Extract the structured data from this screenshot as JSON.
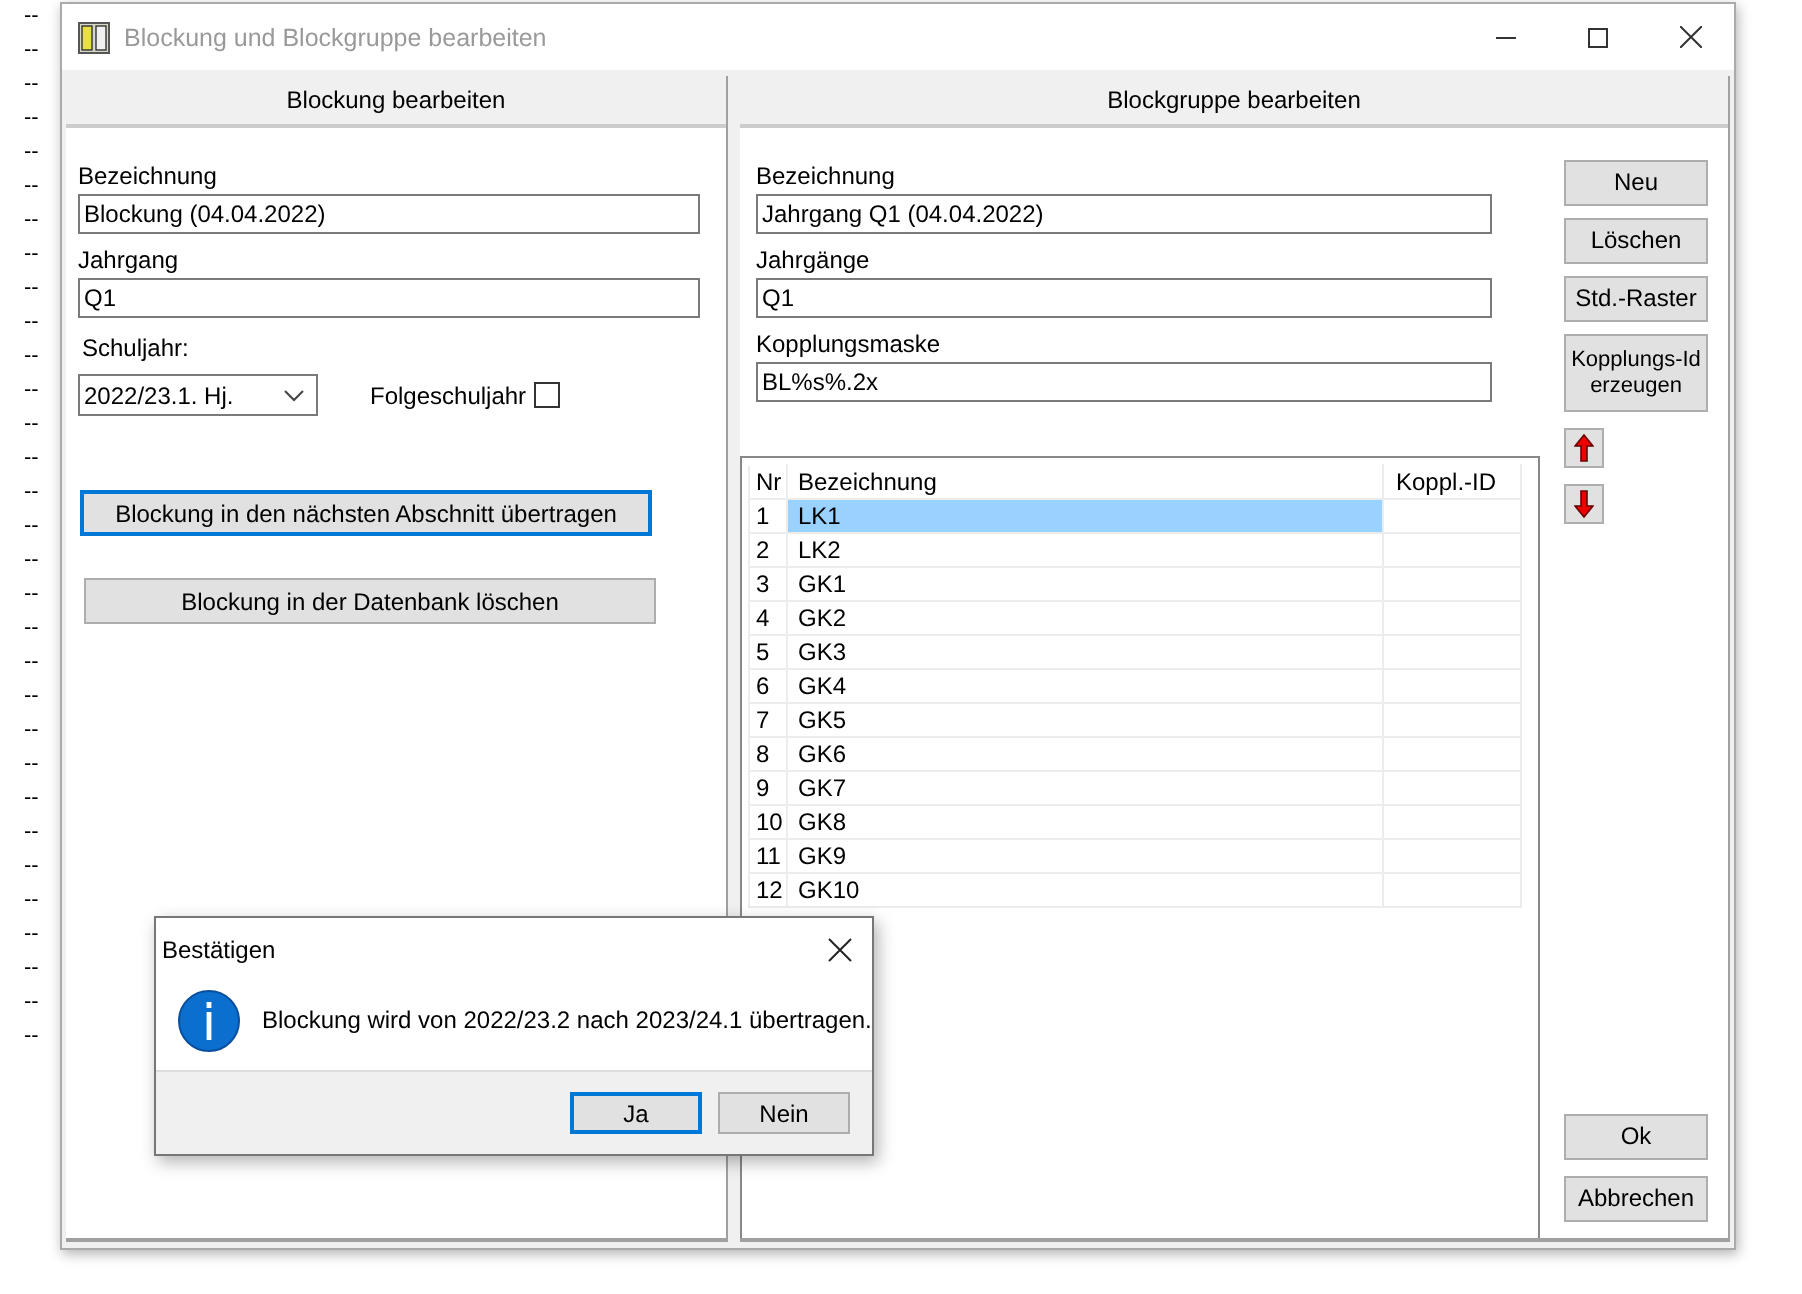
{
  "background_lines": [
    "--",
    "--",
    "--",
    "--",
    "--",
    "--",
    "--",
    "--",
    "--",
    "--",
    "--",
    "--",
    "--",
    "--",
    "--",
    "--",
    "--",
    "--",
    "--",
    "--",
    "--",
    "--",
    "--",
    "--",
    "--",
    "--",
    "--",
    "--",
    "--",
    "--",
    "--"
  ],
  "window": {
    "title": "Blockung und Blockgruppe bearbeiten"
  },
  "blockung": {
    "header": "Blockung bearbeiten",
    "fields": [
      {
        "label": "Bezeichnung",
        "value": "Blockung (04.04.2022)"
      },
      {
        "label": "Jahrgang",
        "value": "Q1"
      }
    ],
    "schuljahr": {
      "label": "Schuljahr:",
      "value": "2022/23.1. Hj."
    },
    "folgeschuljahr": {
      "label": "Folgeschuljahr",
      "checked": false
    },
    "buttons": [
      {
        "label": "Blockung in den nächsten Abschnitt übertragen",
        "focused": true
      },
      {
        "label": "Blockung in der Datenbank löschen",
        "focused": false
      }
    ]
  },
  "blockgruppe": {
    "header": "Blockgruppe bearbeiten",
    "fields": [
      {
        "label": "Bezeichnung",
        "value": "Jahrgang Q1 (04.04.2022)"
      },
      {
        "label": "Jahrgänge",
        "value": "Q1"
      },
      {
        "label": "Kopplungsmaske",
        "value": "BL%s%.2x"
      }
    ],
    "buttons": [
      "Neu",
      "Löschen",
      "Std.-Raster",
      "Kopplungs-Id erzeugen"
    ],
    "table": {
      "columns": [
        "Nr",
        "Bezeichnung",
        "Koppl.-ID"
      ],
      "rows": [
        {
          "nr": "1",
          "bezeichnung": "LK1",
          "selected": true
        },
        {
          "nr": "2",
          "bezeichnung": "LK2",
          "selected": false
        },
        {
          "nr": "3",
          "bezeichnung": "GK1",
          "selected": false
        },
        {
          "nr": "4",
          "bezeichnung": "GK2",
          "selected": false
        },
        {
          "nr": "5",
          "bezeichnung": "GK3",
          "selected": false
        },
        {
          "nr": "6",
          "bezeichnung": "GK4",
          "selected": false
        },
        {
          "nr": "7",
          "bezeichnung": "GK5",
          "selected": false
        },
        {
          "nr": "8",
          "bezeichnung": "GK6",
          "selected": false
        },
        {
          "nr": "9",
          "bezeichnung": "GK7",
          "selected": false
        },
        {
          "nr": "10",
          "bezeichnung": "GK8",
          "selected": false
        },
        {
          "nr": "11",
          "bezeichnung": "GK9",
          "selected": false
        },
        {
          "nr": "12",
          "bezeichnung": "GK10",
          "selected": false
        }
      ]
    },
    "footer_buttons": [
      "Ok",
      "Abbrechen"
    ]
  },
  "dialog": {
    "title": "Bestätigen",
    "message": "Blockung wird von 2022/23.2 nach 2023/24.1 übertragen.",
    "buttons": [
      {
        "label": "Ja",
        "focused": true
      },
      {
        "label": "Nein",
        "focused": false
      }
    ]
  }
}
